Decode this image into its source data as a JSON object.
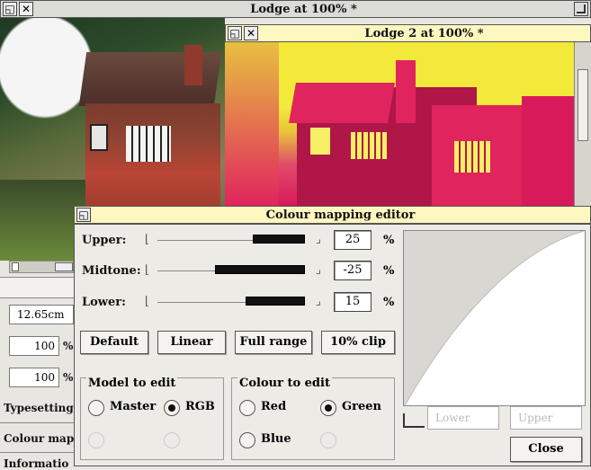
{
  "windows": {
    "lodge": {
      "title": "Lodge at 100% *"
    },
    "lodge2": {
      "title": "Lodge 2 at 100% *"
    }
  },
  "left_panel": {
    "width_value": "12.65cm",
    "scale_x_value": "100",
    "scale_y_value": "100",
    "scale_unit": "%",
    "items": [
      "Typesetting",
      "Colour map",
      "Informatio"
    ]
  },
  "dialog": {
    "title": "Colour mapping editor",
    "sliders": [
      {
        "label": "Upper:",
        "value": "25",
        "unit": "%"
      },
      {
        "label": "Midtone:",
        "value": "-25",
        "unit": "%"
      },
      {
        "label": "Lower:",
        "value": "15",
        "unit": "%"
      }
    ],
    "buttons": [
      "Default",
      "Linear",
      "Full range",
      "10% clip"
    ],
    "model_group": {
      "title": "Model to edit",
      "options": [
        "Master",
        "RGB"
      ],
      "selected": "RGB"
    },
    "colour_group": {
      "title": "Colour to edit",
      "options": [
        "Red",
        "Green",
        "Blue"
      ],
      "selected": "Green"
    },
    "graph_fields": {
      "lower_placeholder": "Lower",
      "upper_placeholder": "Upper"
    },
    "close_label": "Close"
  },
  "colors": {
    "accent_titlebar": "#fff7c0",
    "photo_pink": "#e0245e",
    "photo_yellow": "#f3e93a"
  }
}
